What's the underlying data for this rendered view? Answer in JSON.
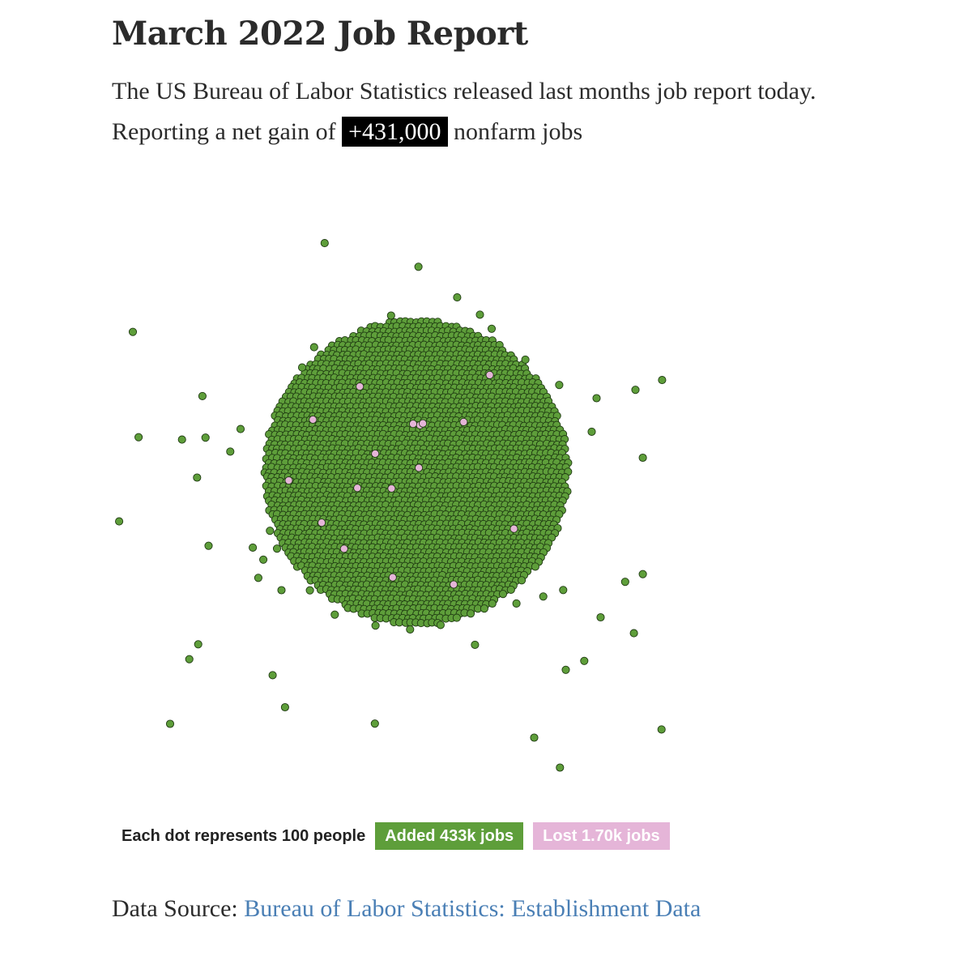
{
  "header": {
    "title": "March 2022 Job Report",
    "subtitle_line1": "The US Bureau of Labor Statistics released last months job report today.",
    "subtitle_prefix": "Reporting a net gain of",
    "net_gain": "+431,000",
    "subtitle_suffix": "nonfarm jobs"
  },
  "legend": {
    "label": "Each dot represents 100 people",
    "added_label": "Added 433k jobs",
    "lost_label": "Lost 1.70k jobs"
  },
  "source": {
    "prefix": "Data Source:",
    "link_text": "Bureau of Labor Statistics: Establishment Data"
  },
  "colors": {
    "added": "#5e9e3a",
    "lost": "#e5b5d8",
    "link": "#4a7fb5",
    "dot_stroke": "#1f3a12"
  },
  "chart_data": {
    "type": "scatter",
    "description_unit": "people per dot",
    "people_per_dot": 100,
    "series": [
      {
        "name": "Added 433k jobs",
        "jobs": 433000,
        "color": "#5e9e3a"
      },
      {
        "name": "Lost 1.70k jobs",
        "jobs": 1700,
        "color": "#e5b5d8"
      }
    ]
  }
}
